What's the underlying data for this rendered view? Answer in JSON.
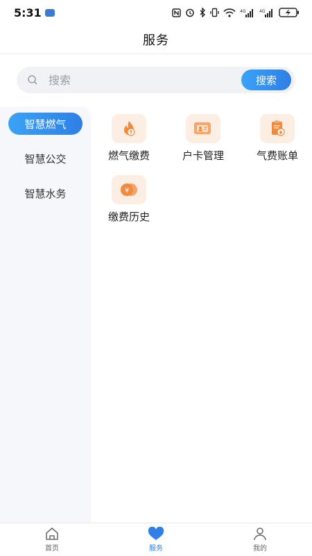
{
  "status_bar": {
    "time": "5:31",
    "icons": [
      "nfc-icon",
      "alarm-icon",
      "bluetooth-icon",
      "vibrate-icon",
      "wifi-icon",
      "signal-4g-icon",
      "signal-4g-icon",
      "battery-charging-icon"
    ]
  },
  "header": {
    "title": "服务"
  },
  "search": {
    "placeholder": "搜索",
    "button_label": "搜索"
  },
  "categories": [
    {
      "label": "智慧燃气",
      "active": true
    },
    {
      "label": "智慧公交",
      "active": false
    },
    {
      "label": "智慧水务",
      "active": false
    }
  ],
  "services": [
    {
      "label": "燃气缴费",
      "icon": "flame-icon"
    },
    {
      "label": "户卡管理",
      "icon": "id-card-icon"
    },
    {
      "label": "气费账单",
      "icon": "bill-icon"
    },
    {
      "label": "缴费历史",
      "icon": "coin-icon"
    }
  ],
  "bottom_nav": [
    {
      "label": "首页",
      "icon": "home-icon",
      "active": false
    },
    {
      "label": "服务",
      "icon": "heart-icon",
      "active": true
    },
    {
      "label": "我的",
      "icon": "person-icon",
      "active": false
    }
  ],
  "colors": {
    "accent": "#2f7fe6",
    "icon_bg": "#fdeee3",
    "icon_fg": "#f08a3c",
    "sidebar_bg": "#f5f7fb"
  }
}
